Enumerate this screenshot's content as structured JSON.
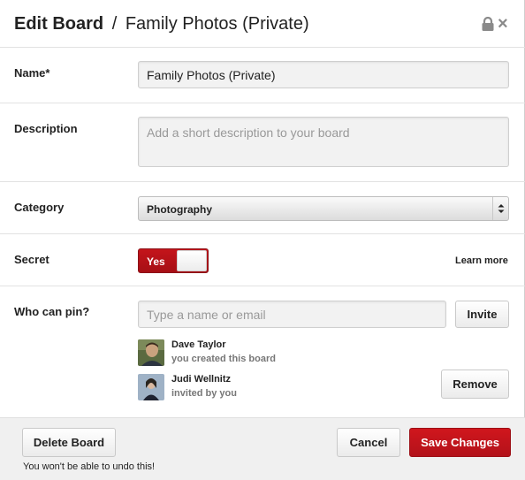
{
  "header": {
    "title_bold": "Edit Board",
    "separator": "/",
    "title_rest": "Family Photos (Private)",
    "lock_icon": "lock-icon",
    "close_icon": "×"
  },
  "fields": {
    "name": {
      "label": "Name*",
      "value": "Family Photos (Private)"
    },
    "description": {
      "label": "Description",
      "placeholder": "Add a short description to your board",
      "value": ""
    },
    "category": {
      "label": "Category",
      "selected": "Photography"
    },
    "secret": {
      "label": "Secret",
      "toggle_label": "Yes",
      "learn_more": "Learn more"
    },
    "who_can_pin": {
      "label": "Who can pin?",
      "placeholder": "Type a name or email",
      "invite_label": "Invite",
      "people": [
        {
          "name": "Dave Taylor",
          "subtext": "you created this board"
        },
        {
          "name": "Judi Wellnitz",
          "subtext": "invited by you",
          "action_label": "Remove"
        }
      ]
    }
  },
  "footer": {
    "delete_label": "Delete Board",
    "warning": "You won't be able to undo this!",
    "cancel_label": "Cancel",
    "save_label": "Save Changes"
  },
  "colors": {
    "accent_red": "#b3121a",
    "footer_bg": "#f0f0f0",
    "divider": "#e2e2e2"
  }
}
